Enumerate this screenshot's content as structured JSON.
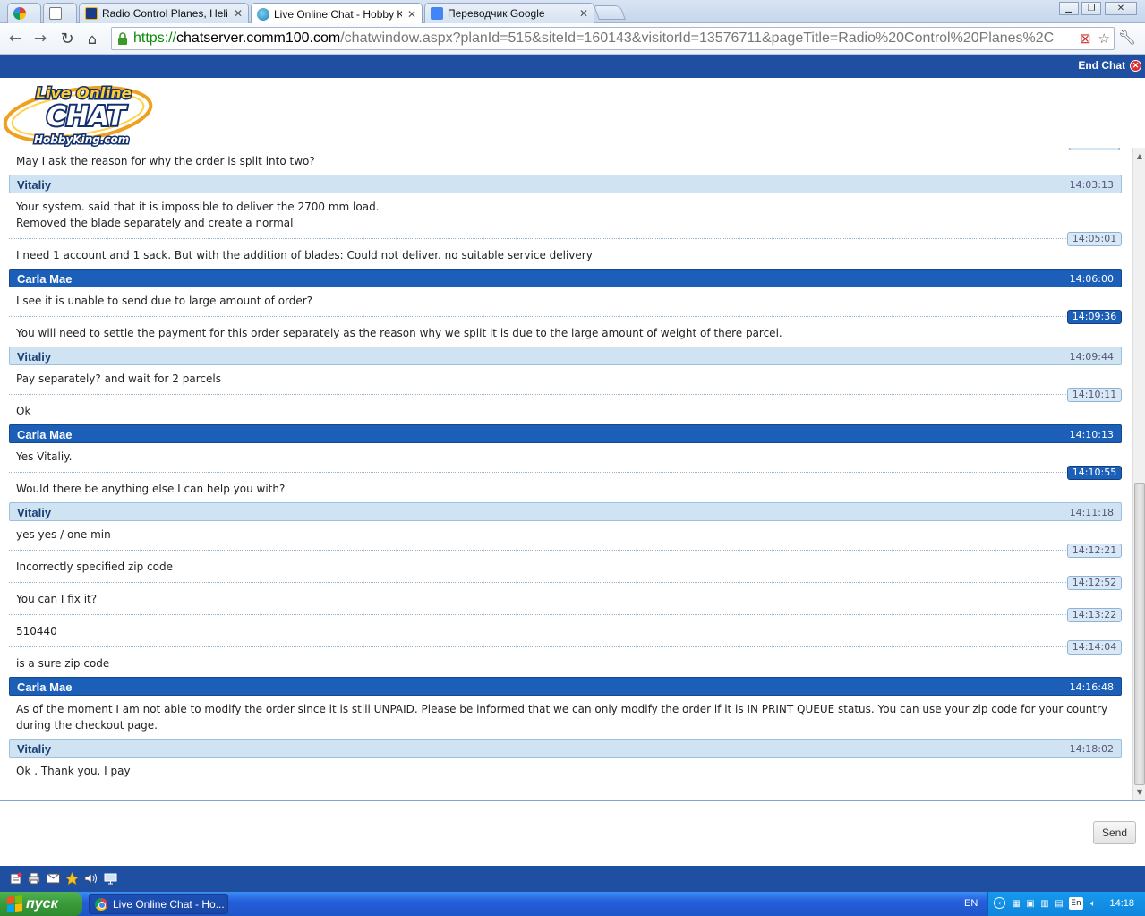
{
  "browser": {
    "tabs": [
      {
        "label": "",
        "icon": "google-s-icon",
        "active": false
      },
      {
        "label": "",
        "icon": "page-icon",
        "active": false
      },
      {
        "label": "Radio Control Planes, Helicop",
        "icon": "hobbyking-icon",
        "active": false
      },
      {
        "label": "Live Online Chat - Hobby King",
        "icon": "globe-icon",
        "active": true
      },
      {
        "label": "Переводчик Google",
        "icon": "google-translate-icon",
        "active": false
      }
    ],
    "url": {
      "scheme": "https://",
      "host": "chatserver.comm100.com",
      "path": "/chatwindow.aspx?planId=515&siteId=160143&visitorId=13576711&pageTitle=Radio%20Control%20Planes%2C"
    }
  },
  "chat": {
    "end_chat_label": "End Chat",
    "logo": {
      "line1": "Live Online",
      "line2": "CHAT",
      "line3": "HobbyKing.com"
    },
    "blocks": [
      {
        "kind": "lines",
        "lines": [
          {
            "text": "May I ask the reason for why the order is split into two?"
          }
        ]
      },
      {
        "kind": "header",
        "role": "visitor",
        "name": "Vitaliy",
        "time": "14:03:13"
      },
      {
        "kind": "lines",
        "role": "visitor",
        "lines": [
          {
            "text": "Your system. said that it is impossible to deliver the 2700 mm load."
          },
          {
            "text": "Removed the blade separately and create a normal"
          },
          {
            "sep_time": "14:05:01"
          },
          {
            "text": "I need 1 account and 1 sack. But with the addition of blades: Could not deliver. no suitable service delivery"
          }
        ]
      },
      {
        "kind": "header",
        "role": "agent",
        "name": "Carla Mae",
        "time": "14:06:00"
      },
      {
        "kind": "lines",
        "role": "agent",
        "lines": [
          {
            "text": "I see it is unable to send due to large amount of order?"
          },
          {
            "sep_time": "14:09:36"
          },
          {
            "text": "You will need to settle the payment for this order separately as the reason why we split it is due to the large amount of weight of there parcel."
          }
        ]
      },
      {
        "kind": "header",
        "role": "visitor",
        "name": "Vitaliy",
        "time": "14:09:44"
      },
      {
        "kind": "lines",
        "role": "visitor",
        "lines": [
          {
            "text": "Pay separately? and wait for 2 parcels"
          },
          {
            "sep_time": "14:10:11"
          },
          {
            "text": "Ok"
          }
        ]
      },
      {
        "kind": "header",
        "role": "agent",
        "name": "Carla Mae",
        "time": "14:10:13"
      },
      {
        "kind": "lines",
        "role": "agent",
        "lines": [
          {
            "text": "Yes Vitaliy."
          },
          {
            "sep_time": "14:10:55"
          },
          {
            "text": "Would there be anything else I can help you with?"
          }
        ]
      },
      {
        "kind": "header",
        "role": "visitor",
        "name": "Vitaliy",
        "time": "14:11:18"
      },
      {
        "kind": "lines",
        "role": "visitor",
        "lines": [
          {
            "text": "yes yes / one min"
          },
          {
            "sep_time": "14:12:21"
          },
          {
            "text": "Incorrectly specified zip code"
          },
          {
            "sep_time": "14:12:52"
          },
          {
            "text": "You can I fix it?"
          },
          {
            "sep_time": "14:13:22"
          },
          {
            "text": "510440"
          },
          {
            "sep_time": "14:14:04"
          },
          {
            "text": "is a sure zip code"
          }
        ]
      },
      {
        "kind": "header",
        "role": "agent",
        "name": "Carla Mae",
        "time": "14:16:48"
      },
      {
        "kind": "lines",
        "role": "agent",
        "lines": [
          {
            "text": "As of the moment I am not able to modify the order since it is still UNPAID. Please be informed that we can only modify the order if it is IN PRINT QUEUE status. You can use your zip code for your country"
          },
          {
            "text": "during the checkout page."
          }
        ]
      },
      {
        "kind": "header",
        "role": "visitor",
        "name": "Vitaliy",
        "time": "14:18:02"
      },
      {
        "kind": "lines",
        "role": "visitor",
        "lines": [
          {
            "text": "Ok . Thank you. I pay"
          }
        ]
      }
    ],
    "send_label": "Send",
    "footer_icons": [
      "transcript-icon",
      "print-icon",
      "email-icon",
      "rate-star-icon",
      "sound-icon",
      "screen-icon"
    ]
  },
  "taskbar": {
    "start_label": "пуск",
    "window_label": "Live Online Chat - Ho...",
    "language": "EN",
    "tray_lang": "En",
    "clock": "14:18"
  }
}
